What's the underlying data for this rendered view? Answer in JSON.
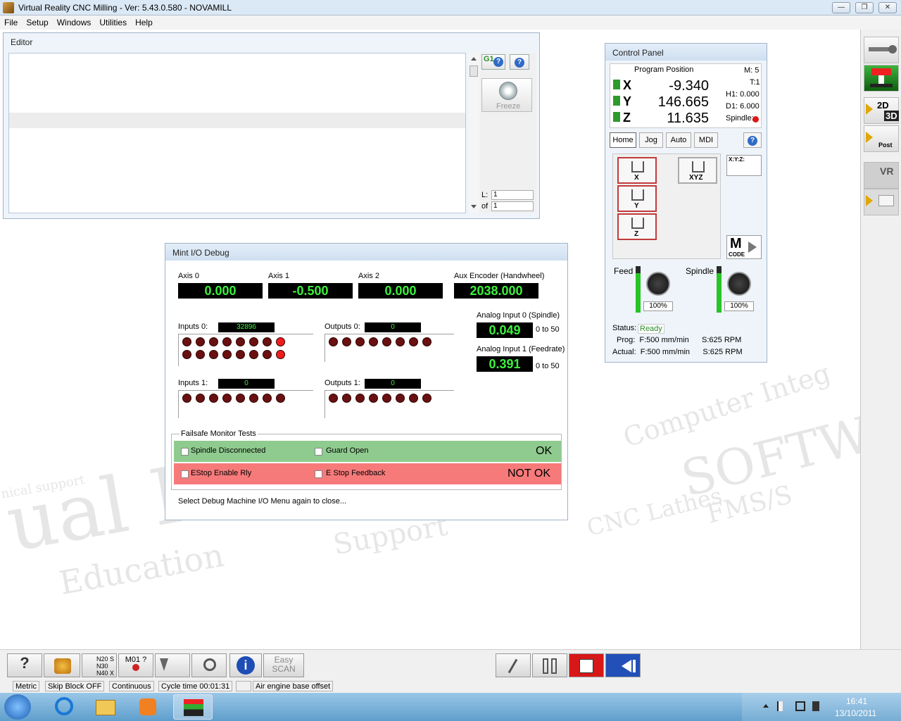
{
  "window": {
    "title": "Virtual Reality CNC Milling  -  Ver: 5.43.0.580 - NOVAMILL",
    "minimize_glyph": "—",
    "maximize_glyph": "❐",
    "close_glyph": "✕"
  },
  "menu": [
    "File",
    "Setup",
    "Windows",
    "Utilities",
    "Help"
  ],
  "editor": {
    "title": "Editor",
    "g1_label": "G1",
    "help_glyph": "?",
    "freeze_label": "Freeze",
    "line_label": "L:",
    "line_value": "1",
    "of_label": "of",
    "of_value": "1"
  },
  "control_panel": {
    "title": "Control Panel",
    "position_header": "Program Position",
    "axes": [
      {
        "name": "X",
        "value": "-9.340"
      },
      {
        "name": "Y",
        "value": "146.665"
      },
      {
        "name": "Z",
        "value": "11.635"
      }
    ],
    "m_code": "M: 5",
    "t_code": "T:1",
    "h1": "H1: 0.000",
    "d1": "D1: 6.000",
    "spindle_label": "Spindle:",
    "tabs": [
      "Home",
      "Jog",
      "Auto",
      "MDI"
    ],
    "help_glyph": "?",
    "home_buttons": [
      "X",
      "Y",
      "Z"
    ],
    "home_all_label": "XYZ",
    "xyz_label": "X:Y:Z:",
    "mcode_label": "M",
    "mcode_sub": "CODE",
    "feed_label": "Feed",
    "spindle_override_label": "Spindle",
    "feed_pct": "100%",
    "spindle_pct": "100%",
    "feed_level": 0.85,
    "spindle_level": 0.85,
    "status_label": "Status:",
    "status_value": "Ready",
    "prog_line": "Prog:  F:500 mm/min      S:625 RPM",
    "actual_line": "Actual:  F:500 mm/min      S:625 RPM"
  },
  "debug": {
    "title": "Mint I/O Debug",
    "axis0_label": "Axis 0",
    "axis0_value": "0.000",
    "axis1_label": "Axis 1",
    "axis1_value": "-0.500",
    "axis2_label": "Axis 2",
    "axis2_value": "0.000",
    "aux_label": "Aux Encoder (Handwheel)",
    "aux_value": "2038.000",
    "inputs0_label": "Inputs 0:",
    "inputs0_value": "32896",
    "inputs0_leds": [
      0,
      0,
      0,
      0,
      0,
      0,
      0,
      1,
      0,
      0,
      0,
      0,
      0,
      0,
      0,
      1
    ],
    "outputs0_label": "Outputs 0:",
    "outputs0_value": "0",
    "inputs1_label": "Inputs 1:",
    "inputs1_value": "0",
    "outputs1_label": "Outputs 1:",
    "outputs1_value": "0",
    "analog0_label": "Analog Input 0 (Spindle)",
    "analog0_value": "0.049",
    "analog0_range": "0 to 50",
    "analog1_label": "Analog Input 1 (Feedrate)",
    "analog1_value": "0.391",
    "analog1_range": "0 to 50",
    "failsafe_title": "Failsafe Monitor Tests",
    "spindle_disconnected": "Spindle Disconnected",
    "guard_open": "Guard Open",
    "ok_label": "OK",
    "estop_enable": "EStop Enable Rly",
    "estop_feedback": "E Stop Feedback",
    "notok_label": "NOT OK",
    "footer": "Select Debug Machine I/O Menu again to close..."
  },
  "right_toolbar": {
    "btn_2d3d_top": "2D",
    "btn_2d3d_bottom": "3D",
    "post_label": "Post",
    "vr_label": "VR"
  },
  "bottom_toolbar": {
    "m01_label": "M01 ?",
    "block_lines": [
      "N20 S",
      "N30",
      "N40 X"
    ],
    "easy_scan": "Easy SCAN"
  },
  "status_bar": [
    "Metric",
    "Skip Block OFF",
    "Continuous",
    "Cycle time 00:01:31",
    "",
    "Air engine base offset"
  ],
  "taskbar": {
    "time": "16:41",
    "date": "13/10/2011"
  },
  "watermark": [
    "ual R",
    "Education",
    "Support",
    "Computer Integ",
    "SOFTW",
    "CNC Lathes",
    "FMS/S",
    "nical support"
  ],
  "colors": {
    "display_bg": "#000000",
    "display_text": "#3cf13c",
    "ok_bg": "#8fcb8f",
    "notok_bg": "#f77a7a",
    "led_off": "#6a1010",
    "led_on": "#f21c1c"
  }
}
